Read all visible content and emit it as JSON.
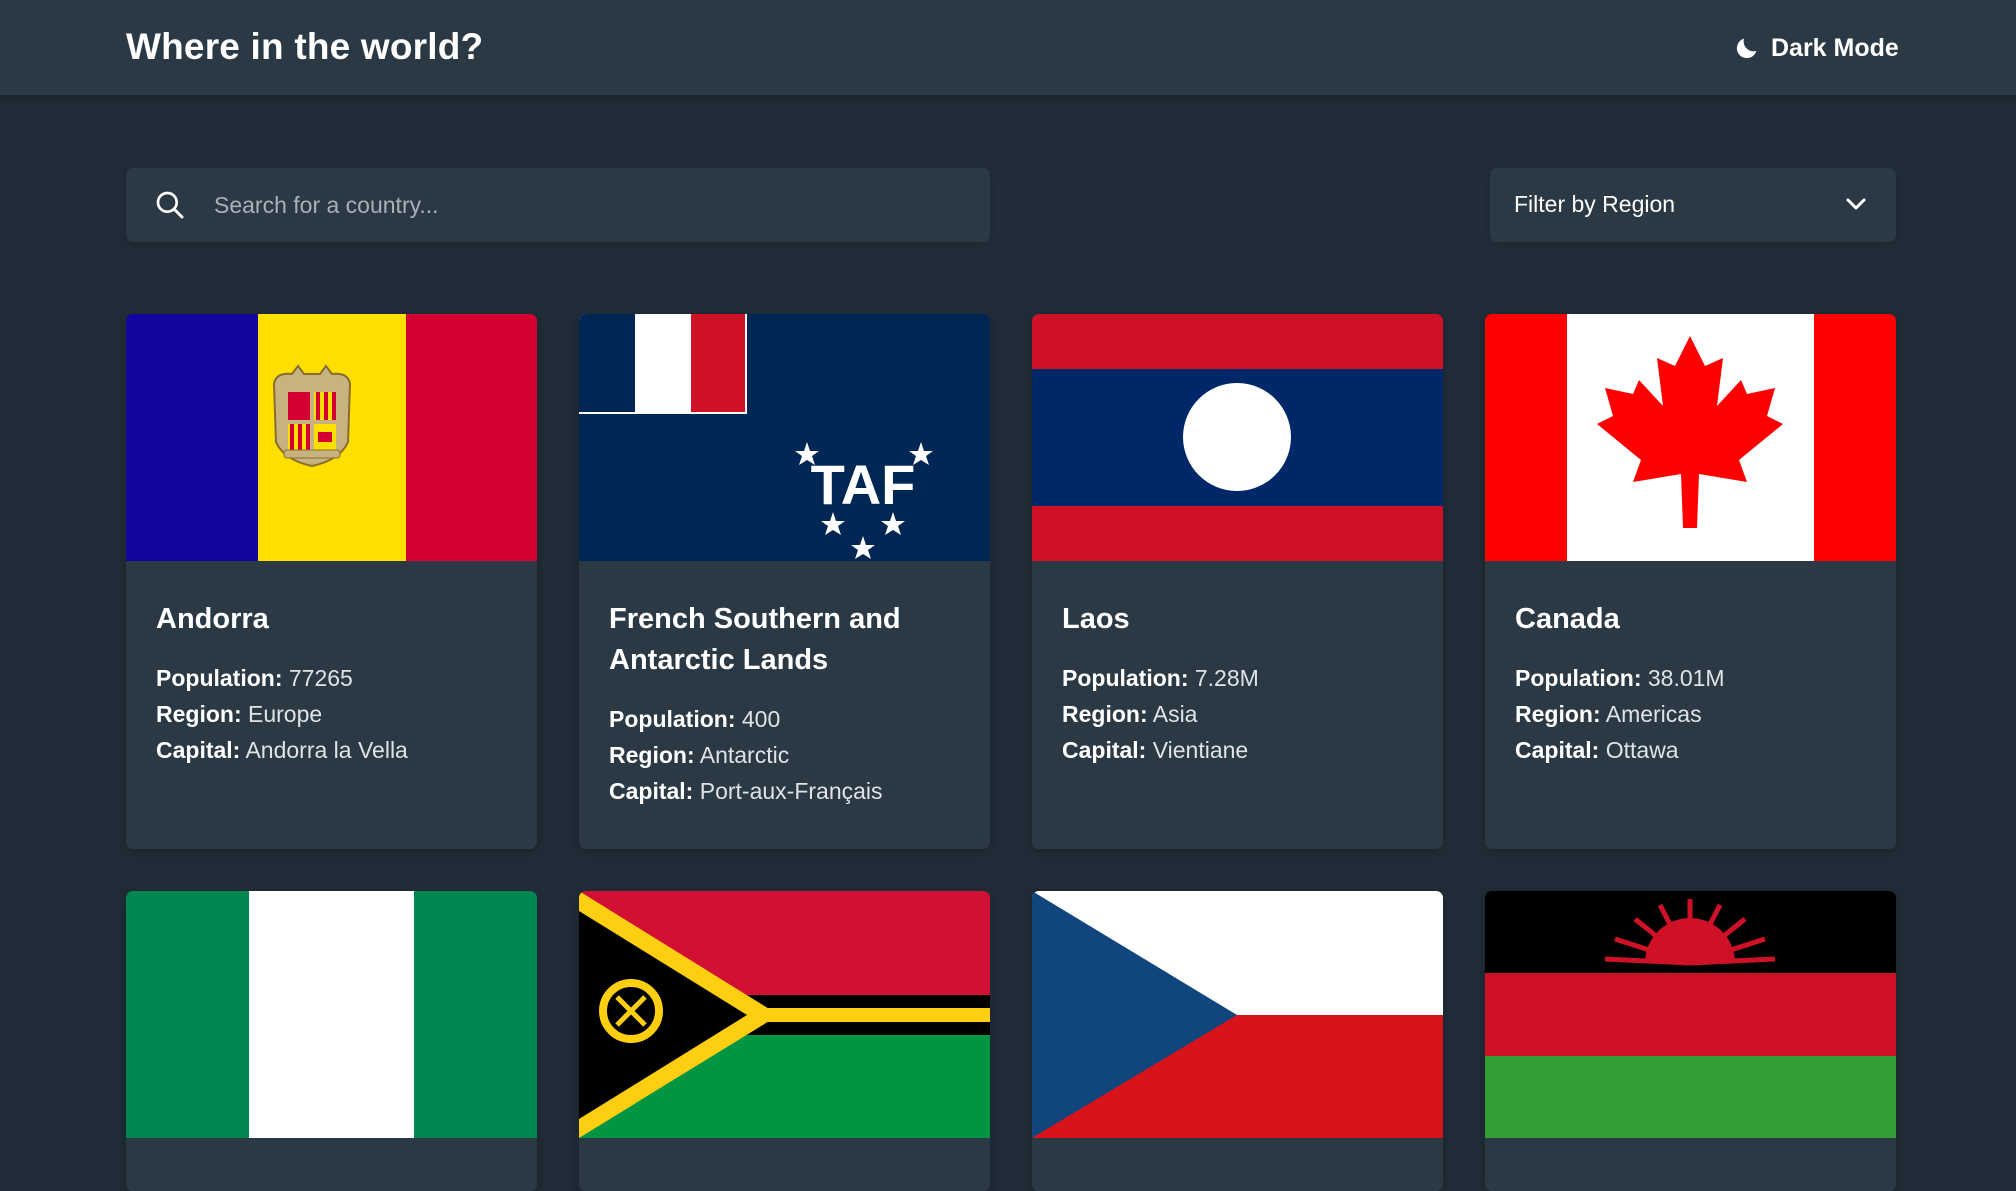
{
  "header": {
    "title": "Where in the world?",
    "mode_label": "Dark Mode"
  },
  "search": {
    "placeholder": "Search for a country..."
  },
  "filter": {
    "label": "Filter by Region"
  },
  "labels": {
    "population": "Population:",
    "region": "Region:",
    "capital": "Capital:"
  },
  "countries": [
    {
      "name": "Andorra",
      "population": "77265",
      "region": "Europe",
      "capital": "Andorra la Vella",
      "flag_icon": "andorra-flag"
    },
    {
      "name": "French Southern and Antarctic Lands",
      "population": "400",
      "region": "Antarctic",
      "capital": "Port-aux-Français",
      "flag_icon": "french-southern-lands-flag"
    },
    {
      "name": "Laos",
      "population": "7.28M",
      "region": "Asia",
      "capital": "Vientiane",
      "flag_icon": "laos-flag"
    },
    {
      "name": "Canada",
      "population": "38.01M",
      "region": "Americas",
      "capital": "Ottawa",
      "flag_icon": "canada-flag"
    },
    {
      "flag_icon": "nigeria-flag"
    },
    {
      "flag_icon": "vanuatu-flag"
    },
    {
      "flag_icon": "czechia-flag"
    },
    {
      "flag_icon": "malawi-flag"
    }
  ],
  "colors": {
    "background": "#202c37",
    "element": "#2b3945",
    "text": "#ffffff"
  }
}
